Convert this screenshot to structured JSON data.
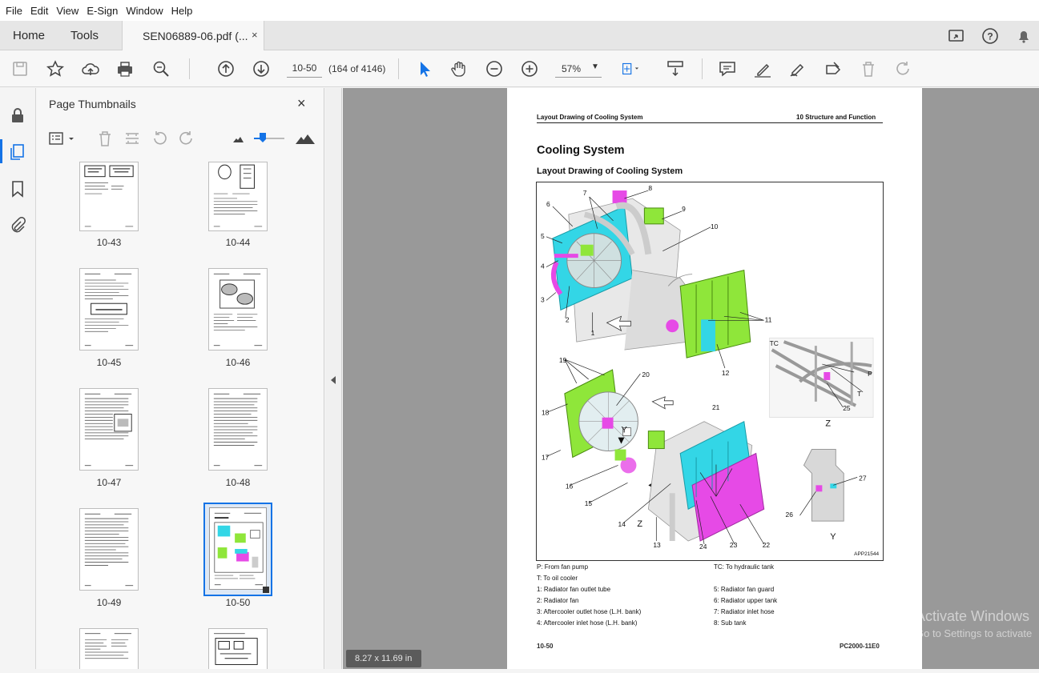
{
  "menu": [
    "File",
    "Edit",
    "View",
    "E-Sign",
    "Window",
    "Help"
  ],
  "tabs": {
    "home": "Home",
    "tools": "Tools",
    "document": "SEN06889-06.pdf (...",
    "close": "×"
  },
  "toolbar": {
    "page_value": "10-50",
    "page_count": "(164 of 4146)",
    "zoom": "57%"
  },
  "panel": {
    "title": "Page Thumbnails",
    "close": "×",
    "thumbnails": [
      "10-43",
      "10-44",
      "10-45",
      "10-46",
      "10-47",
      "10-48",
      "10-49",
      "10-50"
    ],
    "selected": "10-50"
  },
  "document": {
    "header_left": "Layout Drawing of Cooling System",
    "header_right": "10 Structure and Function",
    "title": "Cooling System",
    "subtitle": "Layout Drawing of Cooling System",
    "figure_code": "APP21544",
    "callouts": [
      "1",
      "2",
      "3",
      "4",
      "5",
      "6",
      "7",
      "8",
      "9",
      "10",
      "11",
      "12",
      "13",
      "14",
      "15",
      "16",
      "17",
      "18",
      "19",
      "20",
      "21",
      "22",
      "23",
      "24",
      "25",
      "26",
      "27",
      "Y",
      "Z",
      "TC",
      "P",
      "T"
    ],
    "legend_left": [
      "P: From fan pump",
      "T: To oil cooler",
      "1: Radiator fan outlet tube",
      "2: Radiator fan",
      "3: Aftercooler outlet hose (L.H. bank)",
      "4: Aftercooler inlet hose (L.H. bank)"
    ],
    "legend_right": [
      "TC: To hydraulic tank",
      "",
      "5: Radiator fan guard",
      "6: Radiator upper tank",
      "7: Radiator inlet hose",
      "8: Sub tank"
    ],
    "footer_left": "10-50",
    "footer_right": "PC2000-11E0"
  },
  "status": {
    "page_size": "8.27 x 11.69 in"
  },
  "watermark": {
    "line1": "Activate Windows",
    "line2": "Go to Settings to activate"
  },
  "colors": {
    "accent": "#1473e6",
    "cyan": "#33d6e6",
    "green": "#8fe63a",
    "magenta": "#e64ae6"
  }
}
